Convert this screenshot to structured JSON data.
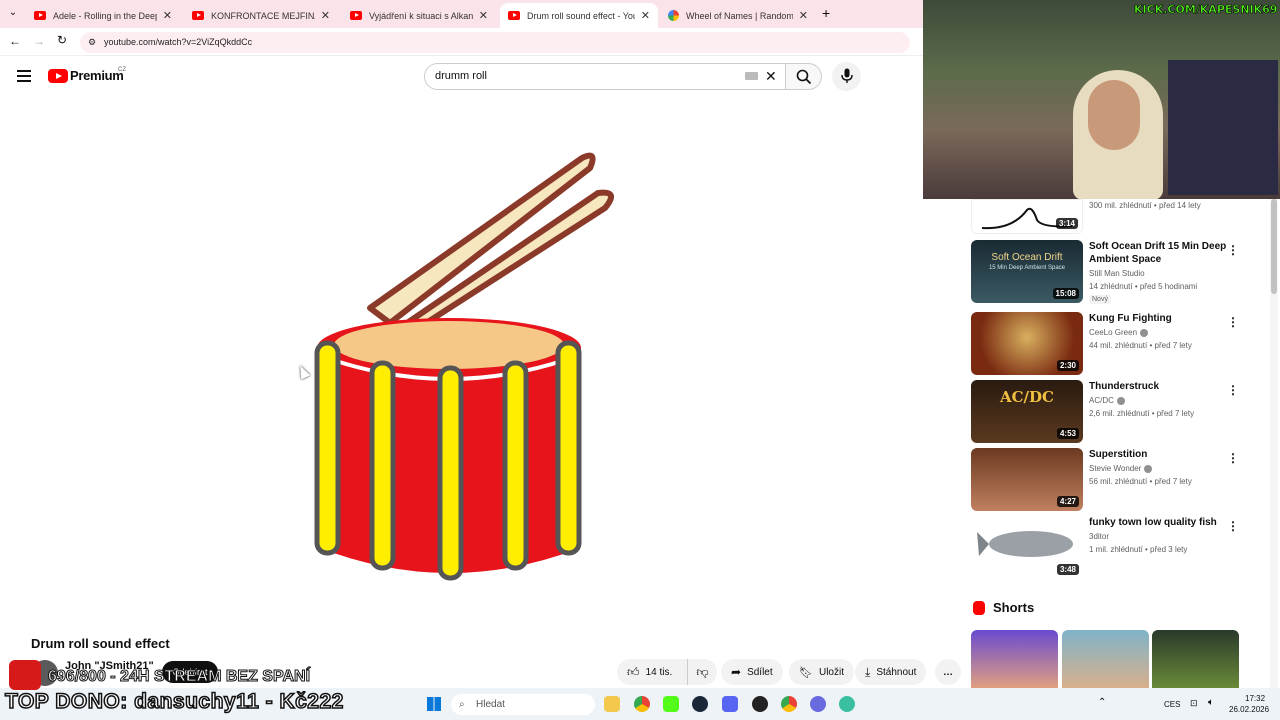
{
  "browser": {
    "tabs": [
      {
        "title": "Adele - Rolling in the Deep (Offi",
        "active": false,
        "icon": "youtube-icon"
      },
      {
        "title": "KONFRONTACE MEJFINA - YouT",
        "active": false,
        "icon": "youtube-icon"
      },
      {
        "title": "Vyjádření k situaci s Alkanem.",
        "active": false,
        "icon": "youtube-icon"
      },
      {
        "title": "Drum roll sound effect - YouTu",
        "active": true,
        "icon": "youtube-icon"
      },
      {
        "title": "Wheel of Names | Random nam",
        "active": false,
        "icon": "wheel-icon"
      }
    ],
    "url": "youtube.com/watch?v=2ViZqQkddCc"
  },
  "youtube": {
    "logo_text": "Premium",
    "logo_region": "CZ",
    "search_value": "drumm roll",
    "video_title": "Drum roll sound effect",
    "channel_name": "John \"JSmith21\"",
    "subscribe_label": "Odebírat",
    "actions": {
      "like_count": "14 tis.",
      "share": "Sdílet",
      "save": "Uložit",
      "download": "Stáhnout"
    },
    "sidebar": {
      "partial_meta": "300 mil. zhlédnutí • před 14 lety",
      "partial_duration": "3:14",
      "items": [
        {
          "title": "Soft Ocean Drift  15 Min Deep Ambient Space",
          "channel": "Still Man Studio",
          "meta": "14 zhlédnutí • před 5 hodinami",
          "badge": "Nový",
          "duration": "15:08",
          "verified": false
        },
        {
          "title": "Kung Fu Fighting",
          "channel": "CeeLo Green",
          "meta": "44 mil. zhlédnutí • před 7 lety",
          "duration": "2:30",
          "verified": true
        },
        {
          "title": "Thunderstruck",
          "channel": "AC/DC",
          "meta": "2,6 mil. zhlédnutí • před 7 lety",
          "duration": "4:53",
          "verified": true
        },
        {
          "title": "Superstition",
          "channel": "Stevie Wonder",
          "meta": "56 mil. zhlédnutí • před 7 lety",
          "duration": "4:27",
          "verified": true
        },
        {
          "title": "funky town low quality fish",
          "channel": "3ditor",
          "meta": "1 mil. zhlédnutí • před 3 lety",
          "duration": "3:48",
          "verified": false
        }
      ],
      "thumb_texts": {
        "soft_ocean": "Soft Ocean Drift",
        "soft_ocean_sub": "15 Min Deep Ambient Space",
        "acdc": "AC/DC"
      },
      "shorts_title": "Shorts"
    }
  },
  "stream_overlay": {
    "kick_tag": "KICK.COM/KAPESNIK69",
    "subgoal": "696/800 - 24H STREAM BEZ SPANÍ",
    "top_donation": "TOP DONO: dansuchy11 - Kč222"
  },
  "taskbar": {
    "search_placeholder": "Hledat",
    "language": "CES",
    "time": "17:32",
    "date": "26.02.2026"
  },
  "colors": {
    "yt_red": "#ff0000",
    "kick_green": "#53fc18",
    "tab_bar": "#fbe3ea"
  }
}
